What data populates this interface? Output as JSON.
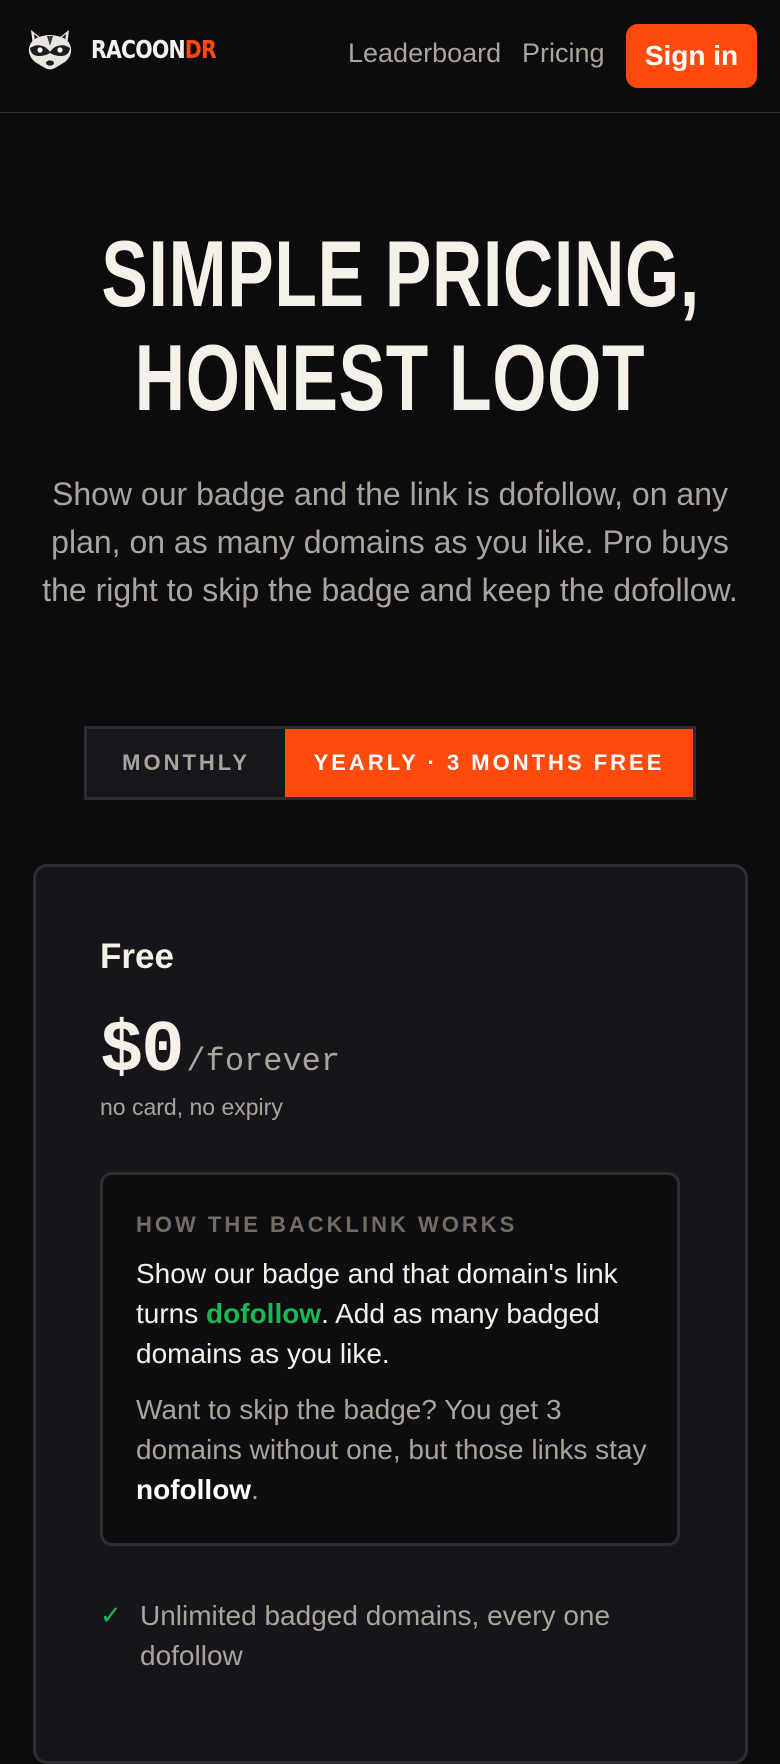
{
  "nav": {
    "brand_main": "RACOON",
    "brand_accent": "DR",
    "links": [
      "Leaderboard",
      "Pricing"
    ],
    "signin_label": "Sign in"
  },
  "hero": {
    "title_line1": "SIMPLE PRICING,",
    "title_line2": "HONEST LOOT",
    "subtitle": "Show our badge and the link is dofollow, on any plan, on as many domains as you like. Pro buys the right to skip the badge and keep the dofollow."
  },
  "billing_toggle": {
    "monthly_label": "MONTHLY",
    "yearly_label": "YEARLY · 3 MONTHS FREE",
    "selected": "yearly"
  },
  "plan": {
    "name": "Free",
    "price": "$0",
    "period": "/forever",
    "note": "no card, no expiry",
    "info": {
      "heading": "HOW THE BACKLINK WORKS",
      "p1_a": "Show our badge and that domain's link turns ",
      "p1_highlight": "dofollow",
      "p1_b": ". Add as many badged domains as you like.",
      "p2_a": "Want to skip the badge? You get 3 domains without one, but those links stay ",
      "p2_bold": "nofollow",
      "p2_b": "."
    },
    "features": [
      "Unlimited badged domains, every one dofollow"
    ]
  },
  "colors": {
    "background": "#0c0c0e",
    "accent": "#ff4a0d",
    "success": "#1bb754",
    "text": "#f6f1e8",
    "muted": "#aaa49a"
  },
  "icons": {
    "logo": "raccoon-icon",
    "feature_check": "check-icon"
  }
}
